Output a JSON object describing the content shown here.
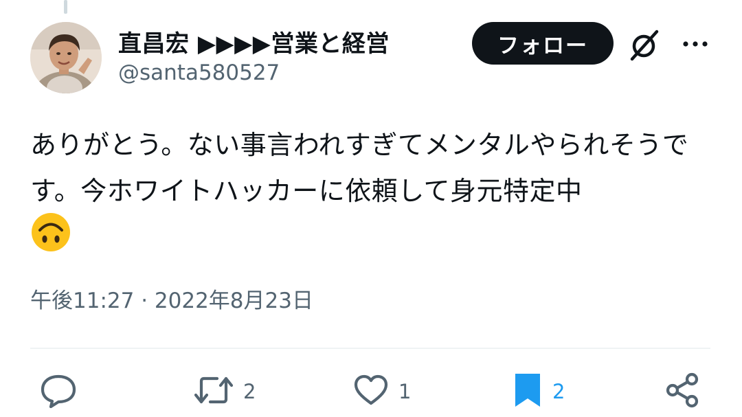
{
  "tweet": {
    "author": {
      "display_name": "直昌宏 ▶▶▶▶営業と経営",
      "handle": "@santa580527"
    },
    "follow_label": "フォロー",
    "text": "ありがとう。ない事言われすぎてメンタルやられそうです。今ホワイトハッカーに依頼して身元特定中",
    "emoji": "upside-down-face",
    "timestamp": "午後11:27 · 2022年8月23日"
  },
  "actions": {
    "reply": {
      "icon": "reply-icon",
      "count": ""
    },
    "retweet": {
      "icon": "retweet-icon",
      "count": "2"
    },
    "like": {
      "icon": "heart-icon",
      "count": "1"
    },
    "bookmark": {
      "icon": "bookmark-icon",
      "count": "2"
    },
    "share": {
      "icon": "share-icon"
    }
  },
  "colors": {
    "text": "#0f1419",
    "secondary": "#536471",
    "accent": "#1d9bf0",
    "follow_bg": "#0f1419",
    "emoji_yellow": "#fcc21b"
  }
}
